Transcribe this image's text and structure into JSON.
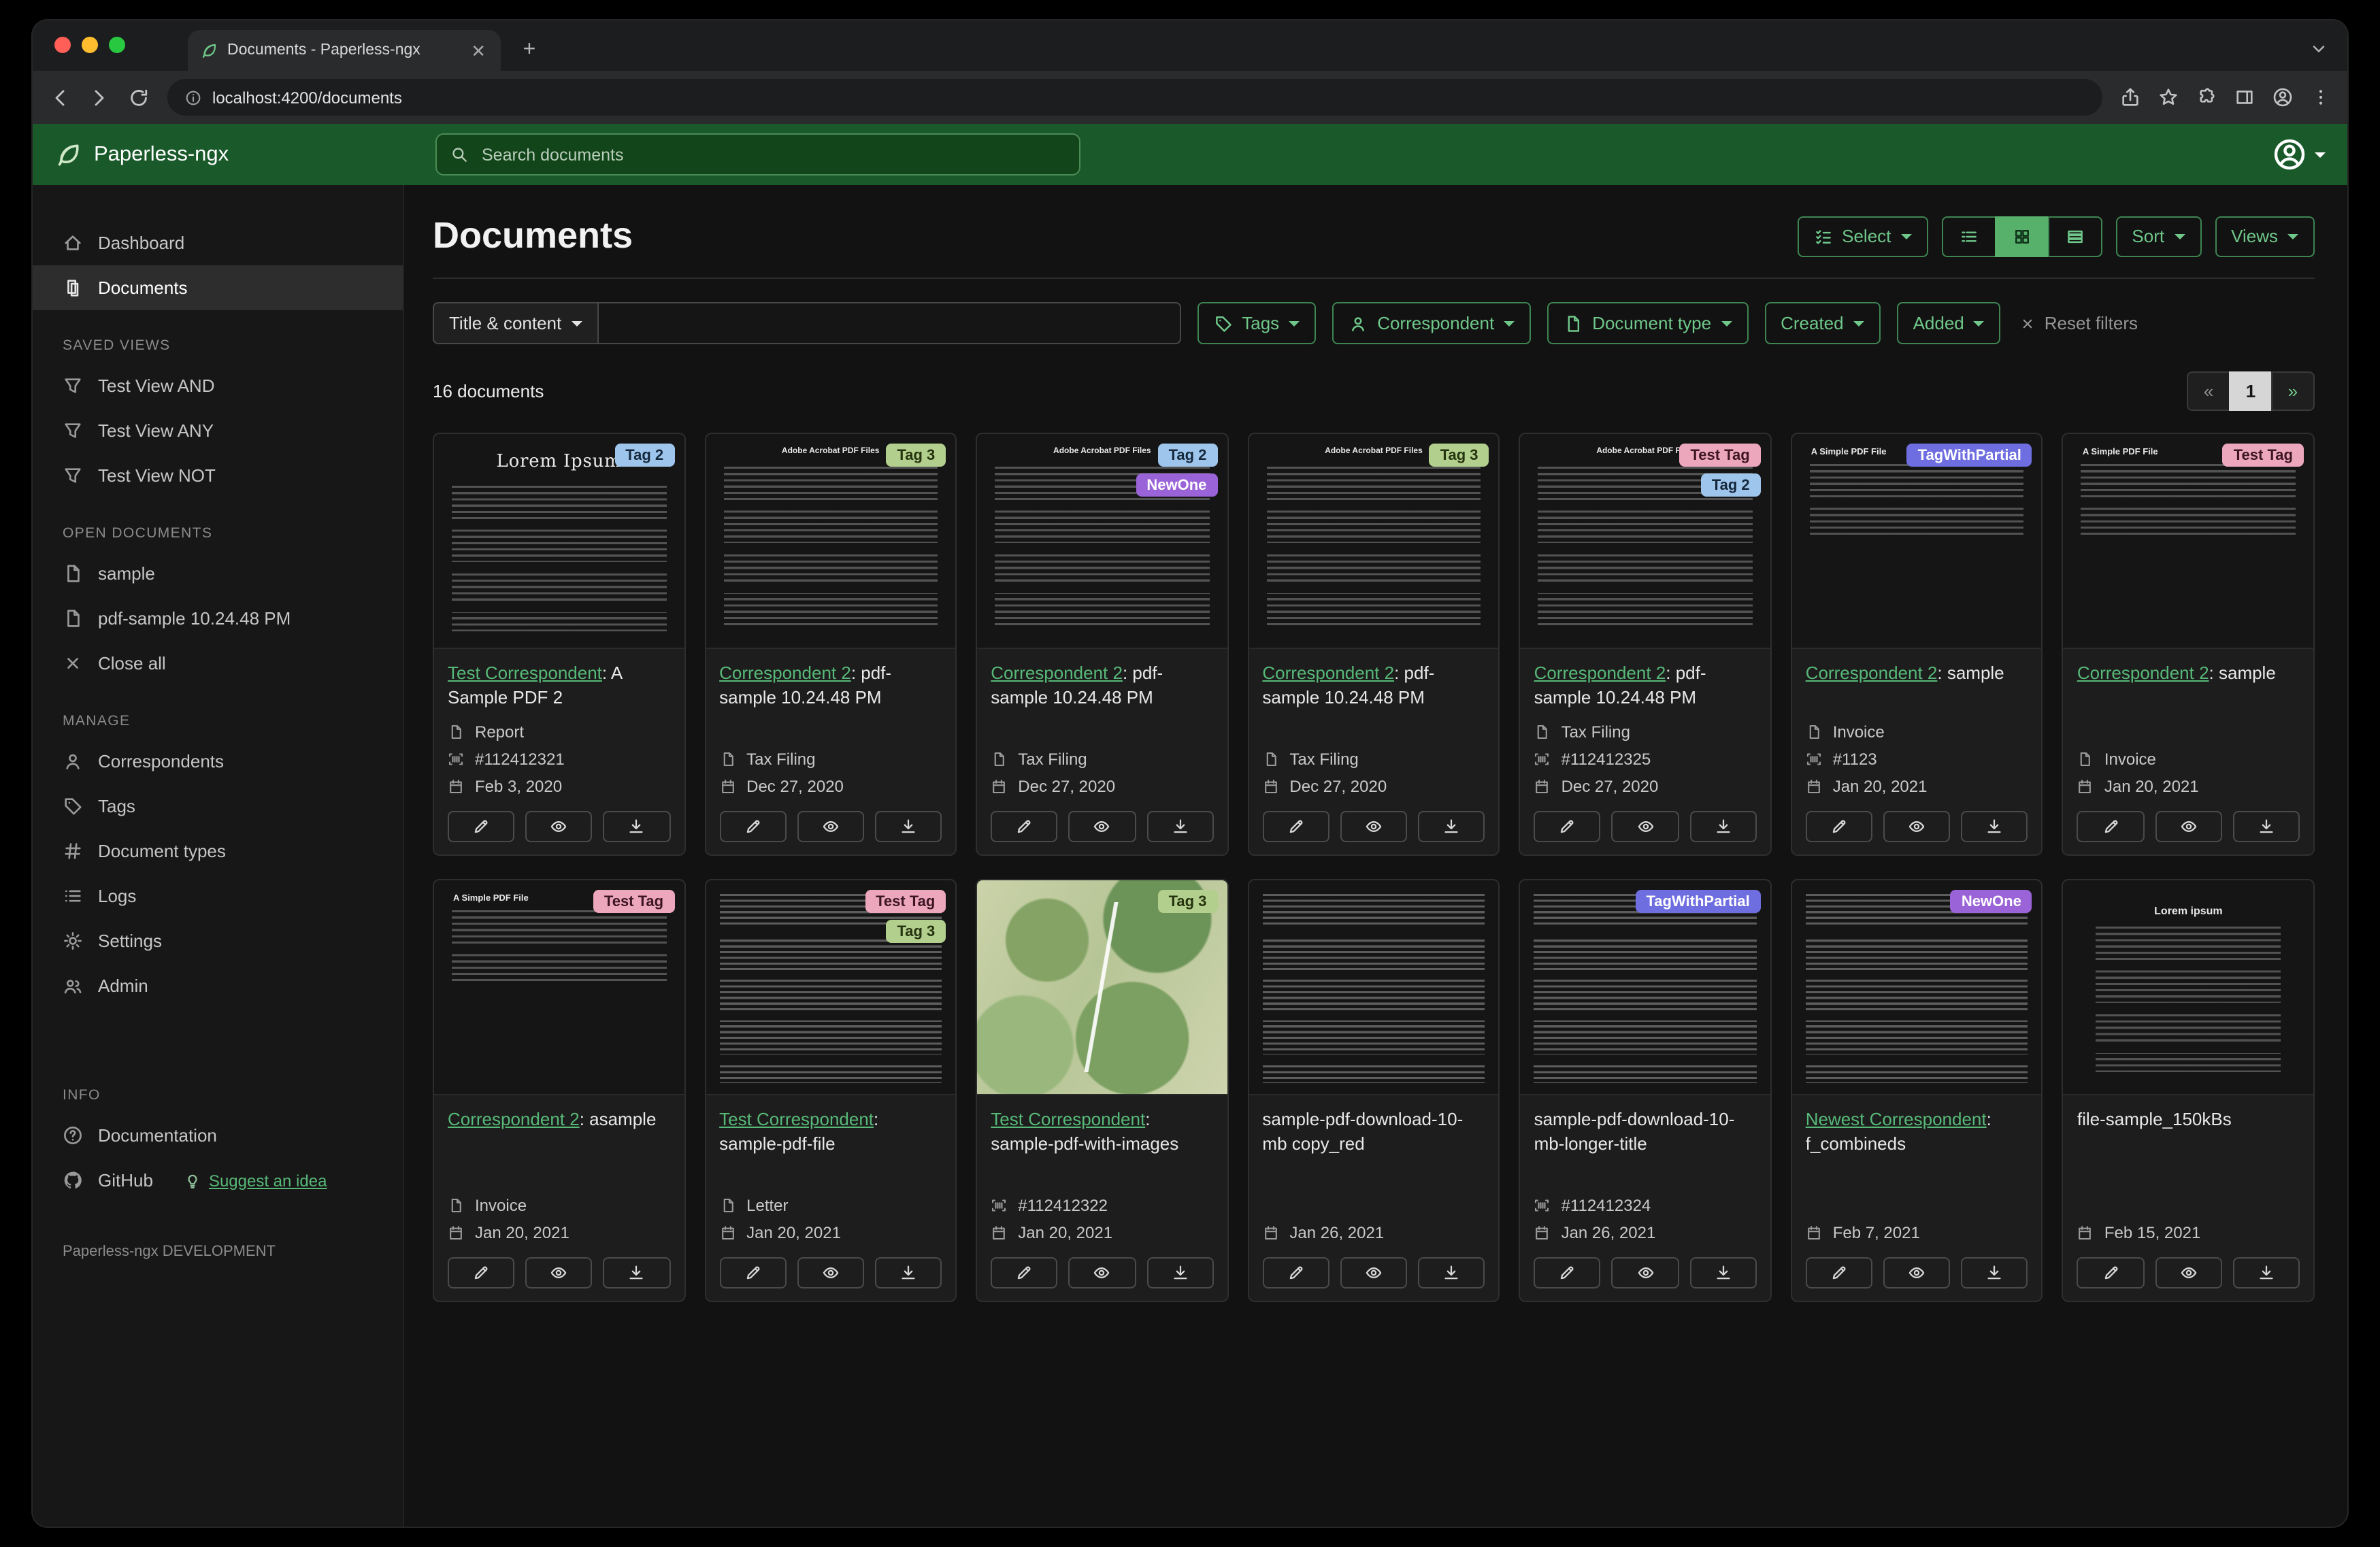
{
  "browser": {
    "tab_title": "Documents - Paperless-ngx",
    "url": "localhost:4200/documents"
  },
  "header": {
    "app_name": "Paperless-ngx",
    "search_placeholder": "Search documents"
  },
  "sidebar": {
    "sections": [
      {
        "title": "",
        "items": [
          {
            "icon": "house",
            "label": "Dashboard"
          },
          {
            "icon": "files",
            "label": "Documents",
            "active": true
          }
        ]
      },
      {
        "title": "SAVED VIEWS",
        "items": [
          {
            "icon": "funnel",
            "label": "Test View AND"
          },
          {
            "icon": "funnel",
            "label": "Test View ANY"
          },
          {
            "icon": "funnel",
            "label": "Test View NOT"
          }
        ]
      },
      {
        "title": "OPEN DOCUMENTS",
        "items": [
          {
            "icon": "file",
            "label": "sample"
          },
          {
            "icon": "file",
            "label": "pdf-sample 10.24.48 PM"
          },
          {
            "icon": "x",
            "label": "Close all"
          }
        ]
      },
      {
        "title": "MANAGE",
        "items": [
          {
            "icon": "person",
            "label": "Correspondents"
          },
          {
            "icon": "tag",
            "label": "Tags"
          },
          {
            "icon": "hash",
            "label": "Document types"
          },
          {
            "icon": "list",
            "label": "Logs"
          },
          {
            "icon": "gear",
            "label": "Settings"
          },
          {
            "icon": "people",
            "label": "Admin"
          }
        ]
      },
      {
        "title": "INFO",
        "gap_before": true,
        "items": [
          {
            "icon": "question",
            "label": "Documentation"
          },
          {
            "icon": "github",
            "label": "GitHub",
            "extra": {
              "icon": "bulb",
              "label": "Suggest an idea"
            }
          }
        ]
      }
    ],
    "footer": "Paperless-ngx DEVELOPMENT"
  },
  "toolbar": {
    "title": "Documents",
    "select_label": "Select",
    "view_modes": [
      "list",
      "grid",
      "details"
    ],
    "active_view": "grid",
    "sort_label": "Sort",
    "views_label": "Views"
  },
  "filters": {
    "field_label": "Title & content",
    "input_value": "",
    "tags_label": "Tags",
    "correspondent_label": "Correspondent",
    "document_type_label": "Document type",
    "created_label": "Created",
    "added_label": "Added",
    "reset_label": "Reset filters"
  },
  "results": {
    "count": "16 documents",
    "page_prev": "«",
    "page_current": "1",
    "page_next": "»"
  },
  "tag_colors": {
    "blue": {
      "bg": "#9ec5ec",
      "fg": "#15283c"
    },
    "green": {
      "bg": "#b3cf8d",
      "fg": "#25330e"
    },
    "purple": {
      "bg": "#9a63d8",
      "fg": "#ffffff"
    },
    "pink": {
      "bg": "#eca7bd",
      "fg": "#3d1523"
    },
    "indigo": {
      "bg": "#6e6ee0",
      "fg": "#ffffff"
    }
  },
  "accent_color": "#57b978",
  "card_actions": [
    "edit",
    "view",
    "download"
  ],
  "documents": [
    {
      "tags": [
        {
          "label": "Tag 2",
          "color": "blue"
        }
      ],
      "thumb": {
        "kind": "lorem",
        "heading": "Lorem Ipsum"
      },
      "title_link": "Test Correspondent",
      "title_rest": ": A Sample PDF 2",
      "meta": [
        {
          "icon": "file",
          "text": "Report"
        },
        {
          "icon": "barcode",
          "text": "#112412321"
        },
        {
          "icon": "calendar",
          "text": "Feb 3, 2020"
        }
      ]
    },
    {
      "tags": [
        {
          "label": "Tag 3",
          "color": "green"
        }
      ],
      "thumb": {
        "kind": "acrobat",
        "heading": "Adobe Acrobat PDF Files"
      },
      "title_link": "Correspondent 2",
      "title_rest": ": pdf-sample 10.24.48 PM",
      "meta": [
        {
          "icon": "file",
          "text": "Tax Filing"
        },
        {
          "icon": "calendar",
          "text": "Dec 27, 2020"
        }
      ]
    },
    {
      "tags": [
        {
          "label": "Tag 2",
          "color": "blue"
        },
        {
          "label": "NewOne",
          "color": "purple"
        }
      ],
      "thumb": {
        "kind": "acrobat",
        "heading": "Adobe Acrobat PDF Files"
      },
      "title_link": "Correspondent 2",
      "title_rest": ": pdf-sample 10.24.48 PM",
      "meta": [
        {
          "icon": "file",
          "text": "Tax Filing"
        },
        {
          "icon": "calendar",
          "text": "Dec 27, 2020"
        }
      ]
    },
    {
      "tags": [
        {
          "label": "Tag 3",
          "color": "green"
        }
      ],
      "thumb": {
        "kind": "acrobat",
        "heading": "Adobe Acrobat PDF Files"
      },
      "title_link": "Correspondent 2",
      "title_rest": ": pdf-sample 10.24.48 PM",
      "meta": [
        {
          "icon": "file",
          "text": "Tax Filing"
        },
        {
          "icon": "calendar",
          "text": "Dec 27, 2020"
        }
      ]
    },
    {
      "tags": [
        {
          "label": "Test Tag",
          "color": "pink"
        },
        {
          "label": "Tag 2",
          "color": "blue"
        }
      ],
      "thumb": {
        "kind": "acrobat",
        "heading": "Adobe Acrobat PDF Files"
      },
      "title_link": "Correspondent 2",
      "title_rest": ": pdf-sample 10.24.48 PM",
      "meta": [
        {
          "icon": "file",
          "text": "Tax Filing"
        },
        {
          "icon": "barcode",
          "text": "#112412325"
        },
        {
          "icon": "calendar",
          "text": "Dec 27, 2020"
        }
      ]
    },
    {
      "tags": [
        {
          "label": "TagWithPartial",
          "color": "indigo"
        }
      ],
      "thumb": {
        "kind": "simple",
        "heading": "A Simple PDF File"
      },
      "title_link": "Correspondent 2",
      "title_rest": ": sample",
      "meta": [
        {
          "icon": "file",
          "text": "Invoice"
        },
        {
          "icon": "barcode",
          "text": "#1123"
        },
        {
          "icon": "calendar",
          "text": "Jan 20, 2021"
        }
      ]
    },
    {
      "tags": [
        {
          "label": "Test Tag",
          "color": "pink"
        }
      ],
      "thumb": {
        "kind": "simple",
        "heading": "A Simple PDF File"
      },
      "title_link": "Correspondent 2",
      "title_rest": ": sample",
      "meta": [
        {
          "icon": "file",
          "text": "Invoice"
        },
        {
          "icon": "calendar",
          "text": "Jan 20, 2021"
        }
      ]
    },
    {
      "tags": [
        {
          "label": "Test Tag",
          "color": "pink"
        }
      ],
      "thumb": {
        "kind": "simple",
        "heading": "A Simple PDF File"
      },
      "title_link": "Correspondent 2",
      "title_rest": ": asample",
      "meta": [
        {
          "icon": "file",
          "text": "Invoice"
        },
        {
          "icon": "calendar",
          "text": "Jan 20, 2021"
        }
      ]
    },
    {
      "tags": [
        {
          "label": "Test Tag",
          "color": "pink"
        },
        {
          "label": "Tag 3",
          "color": "green"
        }
      ],
      "thumb": {
        "kind": "dense"
      },
      "title_link": "Test Correspondent",
      "title_rest": ": sample-pdf-file",
      "meta": [
        {
          "icon": "file",
          "text": "Letter"
        },
        {
          "icon": "calendar",
          "text": "Jan 20, 2021"
        }
      ]
    },
    {
      "tags": [
        {
          "label": "Tag 3",
          "color": "green"
        }
      ],
      "thumb": {
        "kind": "map"
      },
      "title_link": "Test Correspondent",
      "title_rest": ": sample-pdf-with-images",
      "meta": [
        {
          "icon": "barcode",
          "text": "#112412322"
        },
        {
          "icon": "calendar",
          "text": "Jan 20, 2021"
        }
      ]
    },
    {
      "tags": [],
      "thumb": {
        "kind": "dense"
      },
      "title_plain": "sample-pdf-download-10-mb copy_red",
      "meta": [
        {
          "icon": "calendar",
          "text": "Jan 26, 2021"
        }
      ]
    },
    {
      "tags": [
        {
          "label": "TagWithPartial",
          "color": "indigo"
        }
      ],
      "thumb": {
        "kind": "dense"
      },
      "title_plain": "sample-pdf-download-10-mb-longer-title",
      "meta": [
        {
          "icon": "barcode",
          "text": "#112412324"
        },
        {
          "icon": "calendar",
          "text": "Jan 26, 2021"
        }
      ]
    },
    {
      "tags": [
        {
          "label": "NewOne",
          "color": "purple"
        }
      ],
      "thumb": {
        "kind": "dense"
      },
      "title_link": "Newest Correspondent",
      "title_rest": ": f_combineds",
      "meta": [
        {
          "icon": "calendar",
          "text": "Feb 7, 2021"
        }
      ]
    },
    {
      "tags": [],
      "thumb": {
        "kind": "center",
        "heading": "Lorem ipsum"
      },
      "title_plain": "file-sample_150kBs",
      "meta": [
        {
          "icon": "calendar",
          "text": "Feb 15, 2021"
        }
      ]
    }
  ]
}
